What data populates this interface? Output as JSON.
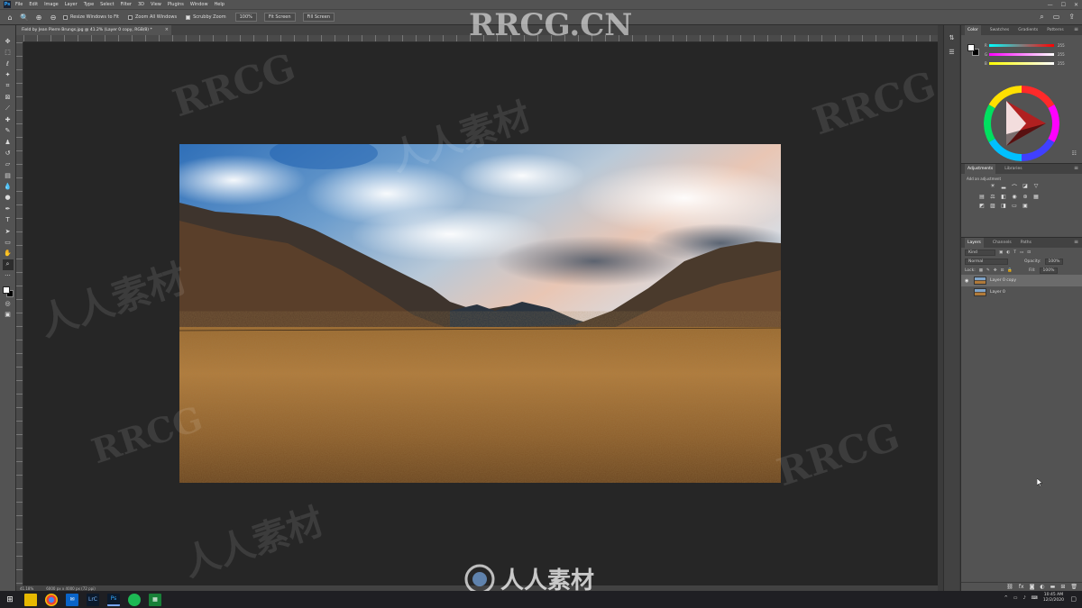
{
  "menubar": {
    "logo": "Ps",
    "items": [
      "File",
      "Edit",
      "Image",
      "Layer",
      "Type",
      "Select",
      "Filter",
      "3D",
      "View",
      "Plugins",
      "Window",
      "Help"
    ],
    "win_min": "—",
    "win_max": "☐",
    "win_close": "✕"
  },
  "options": {
    "resize_windows": "Resize Windows to Fit",
    "zoom_all": "Zoom All Windows",
    "scrubby": "Scrubby Zoom",
    "zoom_pct": "100%",
    "fit_screen": "Fit Screen",
    "fill_screen": "Fill Screen"
  },
  "document": {
    "tab_title": "Field by Jean Pierre Brungs.jpg @ 41.2% (Layer 0 copy, RGB/8) *",
    "close": "×",
    "zoom": "41.18%",
    "dims": "6000 px x 4000 px (72 ppi)"
  },
  "color_panel": {
    "tabs": [
      "Color",
      "Swatches",
      "Gradients",
      "Patterns"
    ],
    "labels": [
      "R",
      "G",
      "B"
    ],
    "values": [
      "255",
      "255",
      "255"
    ]
  },
  "adjustments_panel": {
    "tabs": [
      "Adjustments",
      "Libraries"
    ],
    "subtitle": "Add an adjustment"
  },
  "layers_panel": {
    "tabs": [
      "Layers",
      "Channels",
      "Paths"
    ],
    "kind": "Kind",
    "blend": "Normal",
    "opacity_label": "Opacity:",
    "opacity": "100%",
    "lock_label": "Lock:",
    "fill_label": "Fill:",
    "fill": "100%",
    "layers": [
      {
        "name": "Layer 0 copy",
        "selected": true
      },
      {
        "name": "Layer 0",
        "selected": false
      }
    ]
  },
  "taskbar": {
    "time": "10:45 AM",
    "date": "12/2/2020",
    "apps": [
      "explorer",
      "chrome",
      "mail",
      "lrc",
      "photoshop",
      "spotify",
      "sheets"
    ],
    "app_labels": {
      "lrc": "LrC",
      "photoshop": "Ps"
    }
  },
  "watermarks": [
    "RRCG.CN",
    "RRCG",
    "人人素材",
    "RRCG",
    "人人素材",
    "RRCG",
    "人人素材",
    "RRCG"
  ],
  "footer_brand": "人人素材"
}
